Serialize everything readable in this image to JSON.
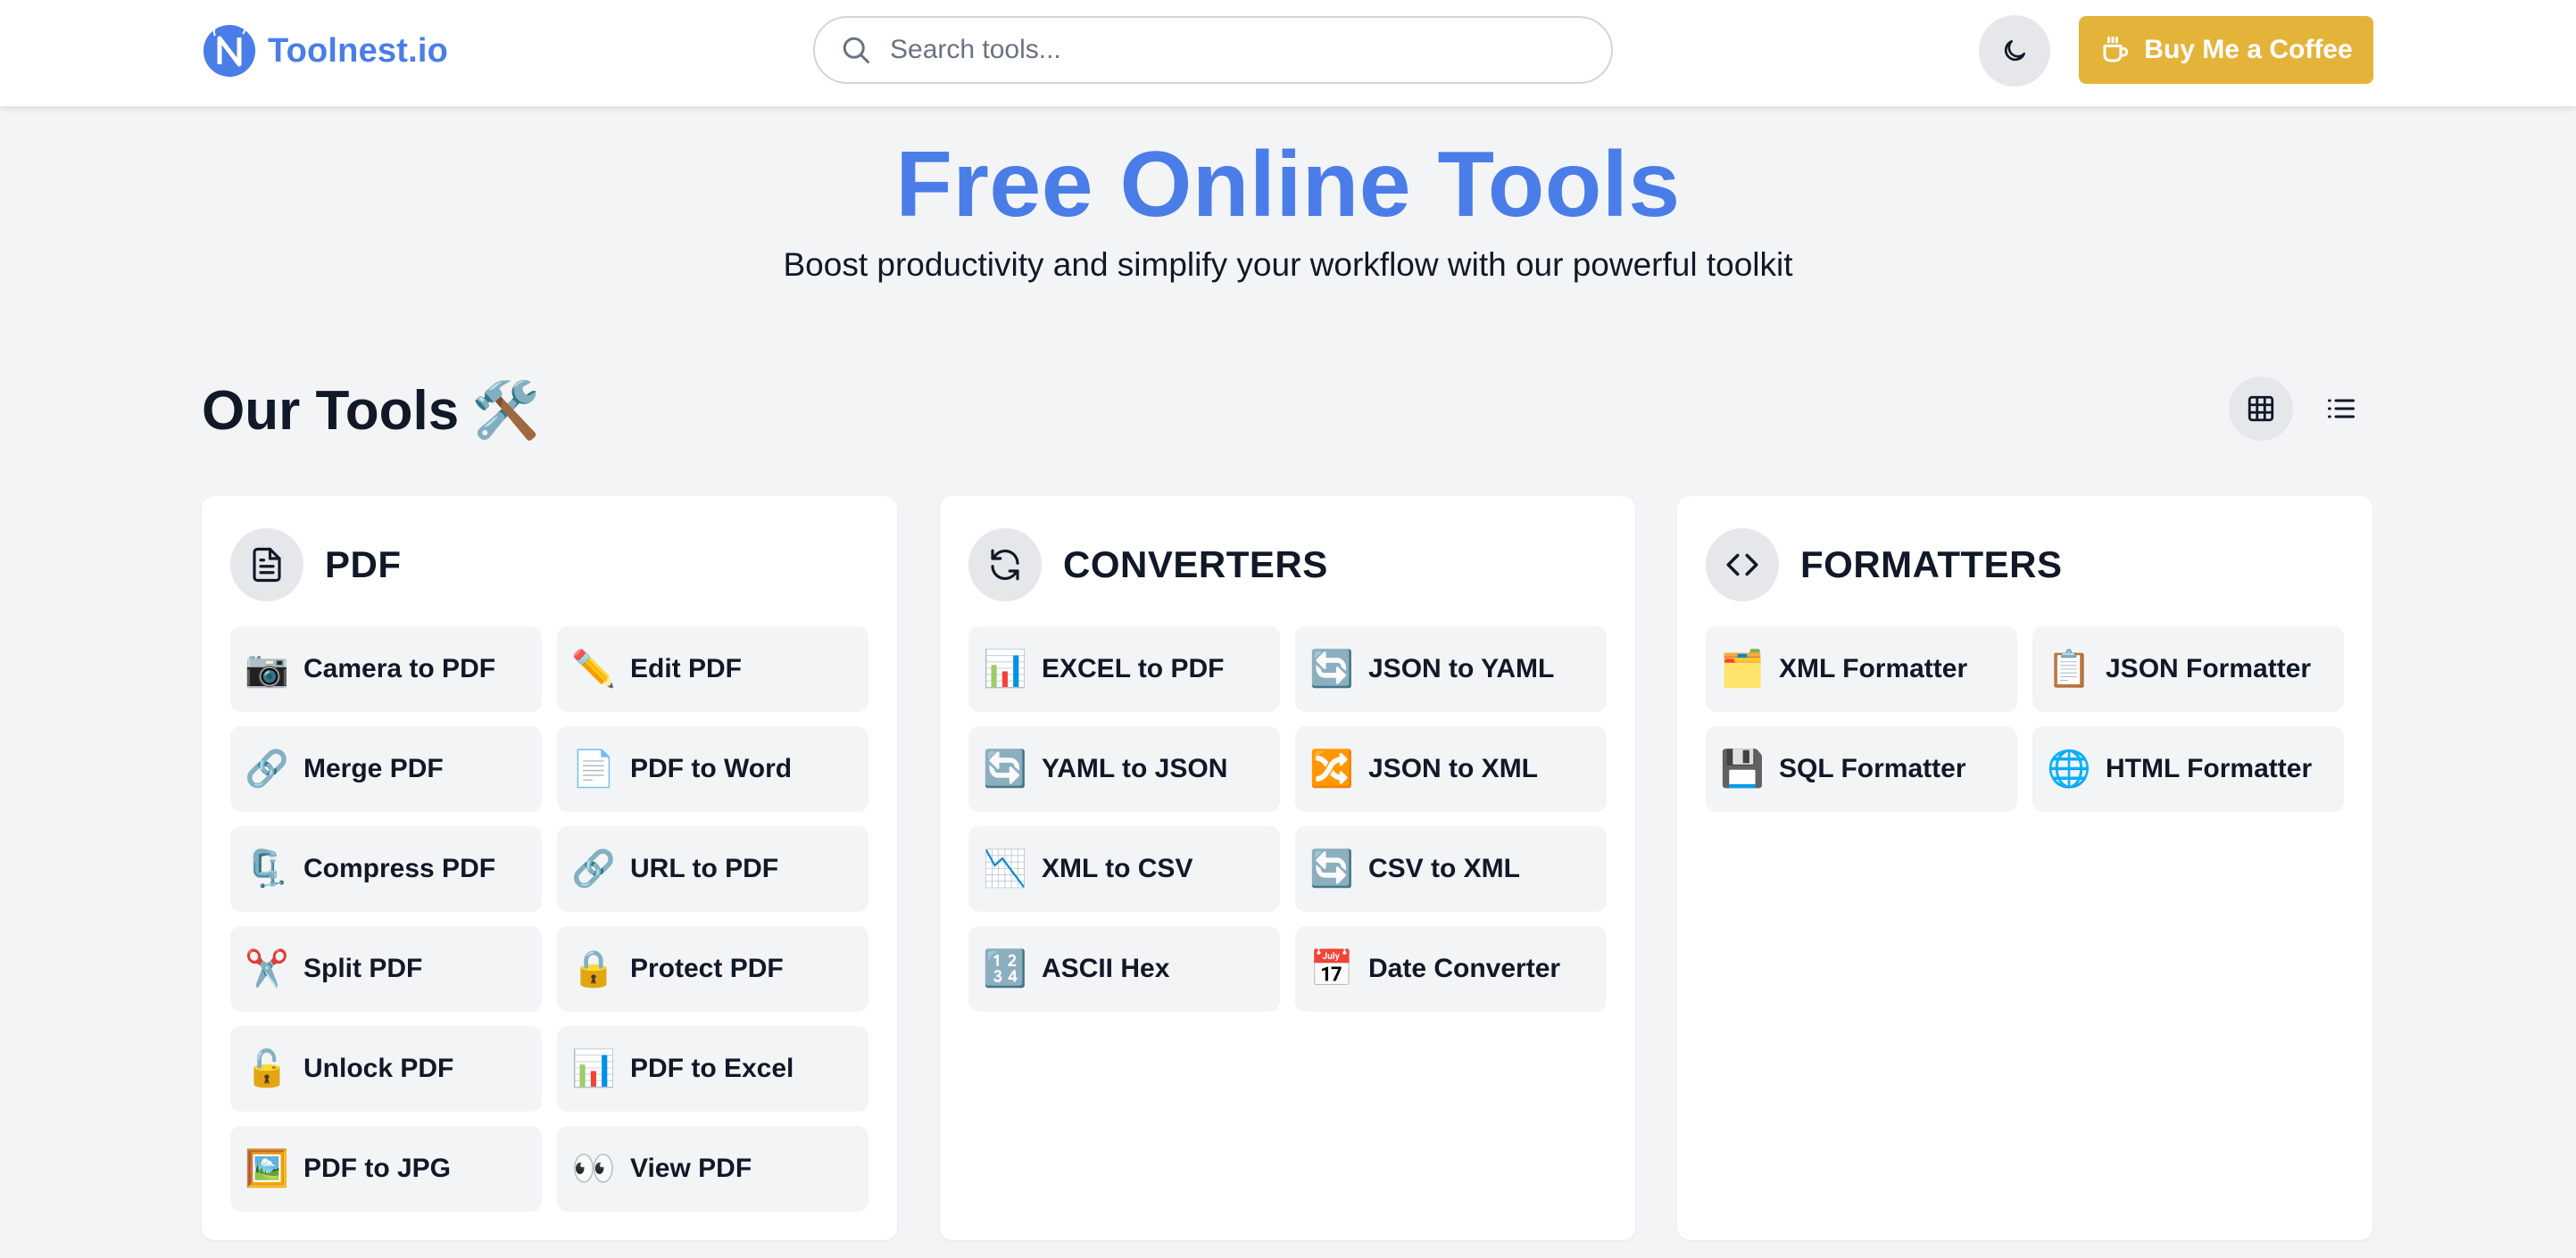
{
  "header": {
    "logo_text": "Toolnest.io",
    "search_placeholder": "Search tools...",
    "coffee_label": "Buy Me a Coffee"
  },
  "hero": {
    "title": "Free Online Tools",
    "subtitle": "Boost productivity and simplify your workflow with our powerful toolkit"
  },
  "section": {
    "title": "Our Tools",
    "title_icon": "🛠️"
  },
  "colors": {
    "brand": "#4a7de8",
    "coffee": "#e4b43a",
    "background": "#f3f4f6"
  },
  "categories": [
    {
      "title": "PDF",
      "icon": "document-icon",
      "tools": [
        {
          "label": "Camera to PDF",
          "emoji": "📷"
        },
        {
          "label": "Edit PDF",
          "emoji": "✏️"
        },
        {
          "label": "Merge PDF",
          "emoji": "🔗"
        },
        {
          "label": "PDF to Word",
          "emoji": "📄"
        },
        {
          "label": "Compress PDF",
          "emoji": "🗜️"
        },
        {
          "label": "URL to PDF",
          "emoji": "🔗"
        },
        {
          "label": "Split PDF",
          "emoji": "✂️"
        },
        {
          "label": "Protect PDF",
          "emoji": "🔒"
        },
        {
          "label": "Unlock PDF",
          "emoji": "🔓"
        },
        {
          "label": "PDF to Excel",
          "emoji": "📊"
        },
        {
          "label": "PDF to JPG",
          "emoji": "🖼️"
        },
        {
          "label": "View PDF",
          "emoji": "👀"
        }
      ]
    },
    {
      "title": "CONVERTERS",
      "icon": "refresh-icon",
      "tools": [
        {
          "label": "EXCEL to PDF",
          "emoji": "📊"
        },
        {
          "label": "JSON to YAML",
          "emoji": "🔄"
        },
        {
          "label": "YAML to JSON",
          "emoji": "🔄"
        },
        {
          "label": "JSON to XML",
          "emoji": "🔀"
        },
        {
          "label": "XML to CSV",
          "emoji": "📉"
        },
        {
          "label": "CSV to XML",
          "emoji": "🔄"
        },
        {
          "label": "ASCII Hex",
          "emoji": "🔢"
        },
        {
          "label": "Date Converter",
          "emoji": "📅"
        }
      ]
    },
    {
      "title": "FORMATTERS",
      "icon": "code-icon",
      "tools": [
        {
          "label": "XML Formatter",
          "emoji": "🗂️"
        },
        {
          "label": "JSON Formatter",
          "emoji": "📋"
        },
        {
          "label": "SQL Formatter",
          "emoji": "💾"
        },
        {
          "label": "HTML Formatter",
          "emoji": "🌐"
        }
      ]
    }
  ]
}
